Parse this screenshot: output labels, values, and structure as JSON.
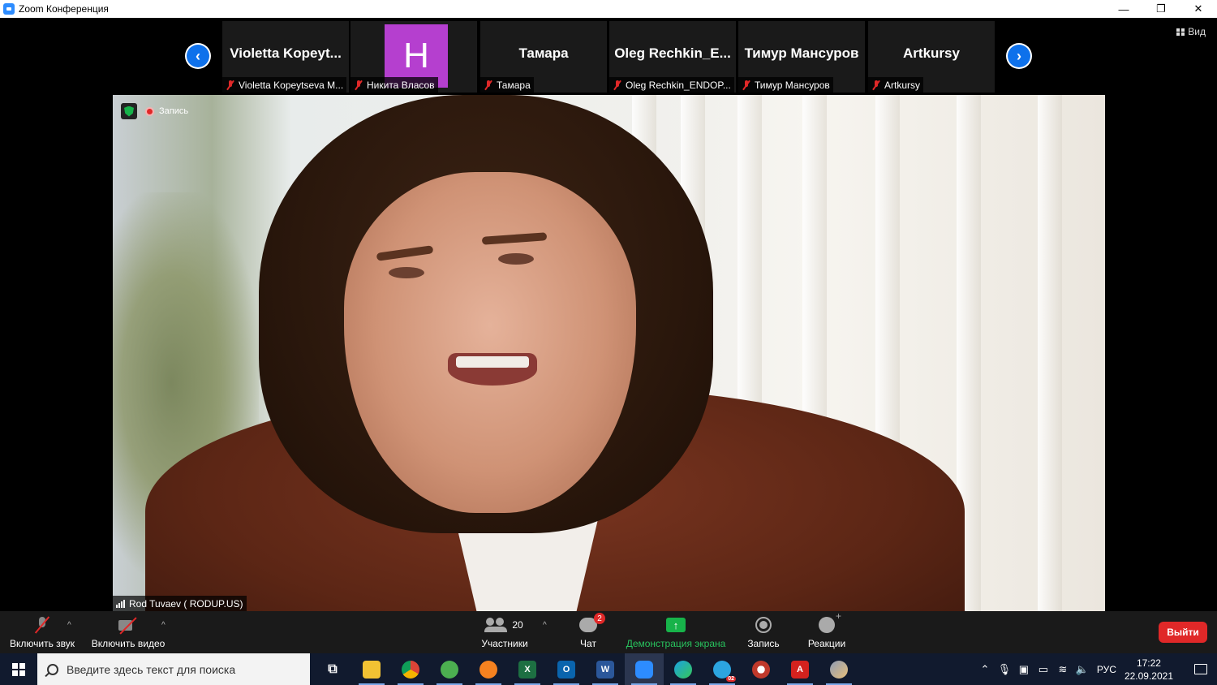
{
  "window": {
    "title": "Zoom Конференция",
    "minimize": "—",
    "restore": "❐",
    "close": "✕"
  },
  "view_button": {
    "label": "Вид"
  },
  "participants_strip": {
    "prev": "‹",
    "next": "›",
    "items": [
      {
        "display": "Violetta  Kopeyt...",
        "label": "Violetta Kopeytseva M..."
      },
      {
        "avatar_letter": "Н",
        "avatar_color": "#b53fcf",
        "label": "Никита Власов"
      },
      {
        "display": "Тамара",
        "label": "Тамара"
      },
      {
        "display": "Oleg  Rechkin_E...",
        "label": "Oleg Rechkin_ENDOP..."
      },
      {
        "display": "Тимур Мансуров",
        "label": "Тимур Мансуров"
      },
      {
        "display": "Artkursy",
        "label": "Artkursy"
      }
    ]
  },
  "main_video": {
    "recording_label": "Запись",
    "speaker_name": "Rod Tuvaev ( RODUP.US)"
  },
  "toolbar": {
    "unmute": "Включить звук",
    "start_video": "Включить видео",
    "participants": "Участники",
    "participants_count": "20",
    "chat": "Чат",
    "chat_badge": "2",
    "share": "Демонстрация экрана",
    "record": "Запись",
    "reactions": "Реакции",
    "leave": "Выйти",
    "caret": "^"
  },
  "taskbar": {
    "search_placeholder": "Введите здесь текст для поиска",
    "apps": [
      {
        "name": "task-view",
        "glyph": "⧉",
        "color": "transparent"
      },
      {
        "name": "file-explorer",
        "glyph": "",
        "color": "#f2c233"
      },
      {
        "name": "chrome",
        "glyph": "",
        "color": "#db4437"
      },
      {
        "name": "globe-app",
        "glyph": "",
        "color": "#4caf50"
      },
      {
        "name": "yandex-browser",
        "glyph": "",
        "color": "#f58220"
      },
      {
        "name": "excel",
        "glyph": "X",
        "color": "#1d6f42"
      },
      {
        "name": "outlook",
        "glyph": "O",
        "color": "#0a64ad"
      },
      {
        "name": "word",
        "glyph": "W",
        "color": "#2b579a"
      },
      {
        "name": "zoom",
        "glyph": "",
        "color": "#2d8cff"
      },
      {
        "name": "edge",
        "glyph": "",
        "color": "#1ba1e2"
      },
      {
        "name": "telegram",
        "glyph": "",
        "color": "#2ca5e0"
      },
      {
        "name": "paint-app",
        "glyph": "",
        "color": "#c0392b"
      },
      {
        "name": "acrobat",
        "glyph": "A",
        "color": "#d4221e"
      },
      {
        "name": "paint-3d",
        "glyph": "",
        "color": "#8e9bb5"
      }
    ],
    "telegram_badge": "02",
    "language": "РУС",
    "time": "17:22",
    "date": "22.09.2021"
  }
}
